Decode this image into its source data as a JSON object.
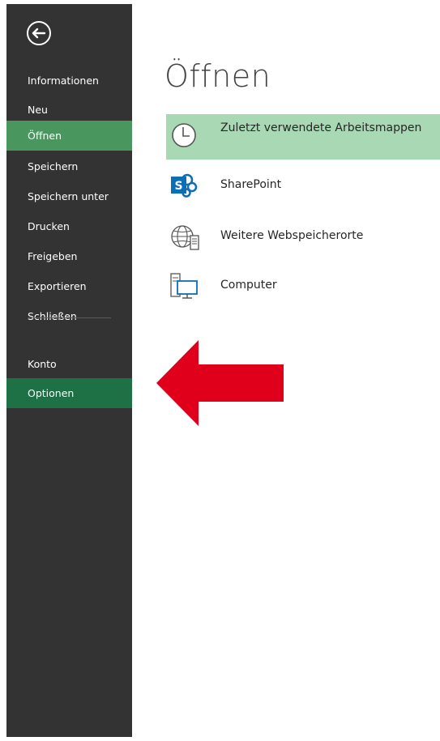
{
  "sidebar": {
    "back_icon": "arrow-left-circle-icon",
    "items": [
      {
        "label": "Informationen",
        "state": "normal"
      },
      {
        "label": "Neu",
        "state": "normal"
      },
      {
        "label": "Öffnen",
        "state": "active"
      },
      {
        "label": "Speichern",
        "state": "normal"
      },
      {
        "label": "Speichern unter",
        "state": "normal"
      },
      {
        "label": "Drucken",
        "state": "normal"
      },
      {
        "label": "Freigeben",
        "state": "normal"
      },
      {
        "label": "Exportieren",
        "state": "normal"
      },
      {
        "label": "Schließen",
        "state": "normal"
      },
      {
        "label": "Konto",
        "state": "normal"
      },
      {
        "label": "Optionen",
        "state": "highlight"
      }
    ]
  },
  "main": {
    "title": "Öffnen",
    "places": [
      {
        "label": "Zuletzt verwendete Arbeitsmappen",
        "icon": "clock-icon",
        "selected": true
      },
      {
        "label": "SharePoint",
        "icon": "sharepoint-icon",
        "selected": false
      },
      {
        "label": "Weitere Webspeicherorte",
        "icon": "globe-server-icon",
        "selected": false
      },
      {
        "label": "Computer",
        "icon": "computer-icon",
        "selected": false
      }
    ]
  },
  "annotation": {
    "icon": "red-arrow-left-icon",
    "color": "#e0001b"
  },
  "colors": {
    "sidebar_bg": "#333333",
    "active_item": "#49975f",
    "highlight_item": "#1e7145",
    "selected_place": "#a8d8b4"
  }
}
